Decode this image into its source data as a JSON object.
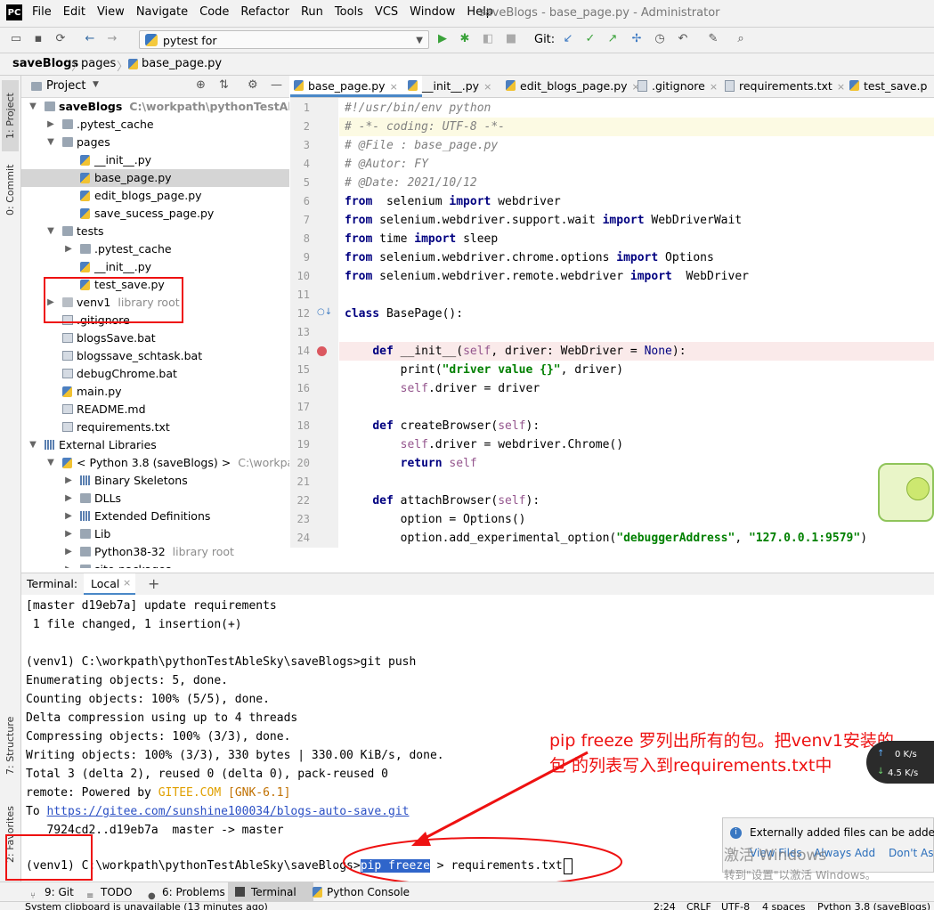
{
  "window": {
    "logo": "PC",
    "title": "saveBlogs - base_page.py - Administrator",
    "menu": [
      "File",
      "Edit",
      "View",
      "Navigate",
      "Code",
      "Refactor",
      "Run",
      "Tools",
      "VCS",
      "Window",
      "Help"
    ]
  },
  "toolbar": {
    "run_config": "pytest for test_save.TestSave.test_continue_edit",
    "git_label": "Git:"
  },
  "breadcrumb": [
    "saveBlogs",
    "pages",
    "base_page.py"
  ],
  "project": {
    "header": "Project",
    "tree": [
      {
        "label": "saveBlogs",
        "hint": "C:\\workpath\\pythonTestAbleSky\\s",
        "depth": 0,
        "arrow": "down",
        "icon": "folder",
        "bold": true
      },
      {
        "label": ".pytest_cache",
        "depth": 1,
        "arrow": "right",
        "icon": "folder"
      },
      {
        "label": "pages",
        "depth": 1,
        "arrow": "down",
        "icon": "folder"
      },
      {
        "label": "__init__.py",
        "depth": 2,
        "icon": "py"
      },
      {
        "label": "base_page.py",
        "depth": 2,
        "icon": "py",
        "selected": true
      },
      {
        "label": "edit_blogs_page.py",
        "depth": 2,
        "icon": "py"
      },
      {
        "label": "save_sucess_page.py",
        "depth": 2,
        "icon": "py"
      },
      {
        "label": "tests",
        "depth": 1,
        "arrow": "down",
        "icon": "folder"
      },
      {
        "label": ".pytest_cache",
        "depth": 2,
        "arrow": "right",
        "icon": "folder"
      },
      {
        "label": "__init__.py",
        "depth": 2,
        "icon": "py"
      },
      {
        "label": "test_save.py",
        "depth": 2,
        "icon": "py"
      },
      {
        "label": "venv1",
        "hint": "library root",
        "depth": 1,
        "arrow": "right",
        "icon": "folder-gray"
      },
      {
        "label": ".gitignore",
        "depth": 1,
        "icon": "file"
      },
      {
        "label": "blogsSave.bat",
        "depth": 1,
        "icon": "file"
      },
      {
        "label": "blogssave_schtask.bat",
        "depth": 1,
        "icon": "file"
      },
      {
        "label": "debugChrome.bat",
        "depth": 1,
        "icon": "file"
      },
      {
        "label": "main.py",
        "depth": 1,
        "icon": "py"
      },
      {
        "label": "README.md",
        "depth": 1,
        "icon": "file"
      },
      {
        "label": "requirements.txt",
        "depth": 1,
        "icon": "file"
      },
      {
        "label": "External Libraries",
        "depth": 0,
        "arrow": "down",
        "icon": "libs"
      },
      {
        "label": "< Python 3.8 (saveBlogs) >",
        "hint": "C:\\workpath\\",
        "depth": 1,
        "arrow": "down",
        "icon": "py"
      },
      {
        "label": "Binary Skeletons",
        "depth": 2,
        "arrow": "right",
        "icon": "libs"
      },
      {
        "label": "DLLs",
        "depth": 2,
        "arrow": "right",
        "icon": "folder"
      },
      {
        "label": "Extended Definitions",
        "depth": 2,
        "arrow": "right",
        "icon": "libs"
      },
      {
        "label": "Lib",
        "depth": 2,
        "arrow": "right",
        "icon": "folder"
      },
      {
        "label": "Python38-32",
        "hint": "library root",
        "depth": 2,
        "arrow": "right",
        "icon": "folder"
      },
      {
        "label": "site-packages",
        "depth": 2,
        "arrow": "right",
        "icon": "folder"
      }
    ]
  },
  "editor_tabs": [
    {
      "label": "base_page.py",
      "active": true
    },
    {
      "label": "__init__.py"
    },
    {
      "label": "edit_blogs_page.py"
    },
    {
      "label": ".gitignore"
    },
    {
      "label": "requirements.txt"
    },
    {
      "label": "test_save.p"
    }
  ],
  "code_lines": [
    {
      "n": "1",
      "t": [
        [
          "cm",
          "#!/usr/bin/env python"
        ]
      ]
    },
    {
      "n": "2",
      "t": [
        [
          "cm",
          "# -*- coding: UTF-8 -*-"
        ]
      ],
      "hl": "current"
    },
    {
      "n": "3",
      "t": [
        [
          "cm",
          "# @File : base_page.py"
        ]
      ]
    },
    {
      "n": "4",
      "t": [
        [
          "cm",
          "# @Autor: FY"
        ]
      ]
    },
    {
      "n": "5",
      "t": [
        [
          "cm",
          "# @Date: 2021/10/12"
        ]
      ]
    },
    {
      "n": "6",
      "t": [
        [
          "kw",
          "from"
        ],
        [
          "",
          "  selenium "
        ],
        [
          "kw",
          "import"
        ],
        [
          "",
          " webdriver"
        ]
      ]
    },
    {
      "n": "7",
      "t": [
        [
          "kw",
          "from"
        ],
        [
          "",
          " selenium.webdriver.support.wait "
        ],
        [
          "kw",
          "import"
        ],
        [
          "",
          " WebDriverWait"
        ]
      ]
    },
    {
      "n": "8",
      "t": [
        [
          "kw",
          "from"
        ],
        [
          "",
          " time "
        ],
        [
          "kw",
          "import"
        ],
        [
          "",
          " sleep"
        ]
      ]
    },
    {
      "n": "9",
      "t": [
        [
          "kw",
          "from"
        ],
        [
          "",
          " selenium.webdriver.chrome.options "
        ],
        [
          "kw",
          "import"
        ],
        [
          "",
          " Options"
        ]
      ]
    },
    {
      "n": "10",
      "t": [
        [
          "kw",
          "from"
        ],
        [
          "",
          " selenium.webdriver.remote.webdriver "
        ],
        [
          "kw",
          "import"
        ],
        [
          "",
          "  WebDriver"
        ]
      ]
    },
    {
      "n": "11",
      "t": []
    },
    {
      "n": "12",
      "t": [
        [
          "kw",
          "class"
        ],
        [
          "",
          " BasePage():"
        ]
      ]
    },
    {
      "n": "13",
      "t": []
    },
    {
      "n": "14",
      "t": [
        [
          "",
          "    "
        ],
        [
          "kw",
          "def"
        ],
        [
          "",
          " __init__("
        ],
        [
          "slf",
          "self"
        ],
        [
          "",
          ", driver: WebDriver = "
        ],
        [
          "bi",
          "None"
        ],
        [
          "",
          "):"
        ]
      ],
      "hl": "breakpoint"
    },
    {
      "n": "15",
      "t": [
        [
          "",
          "        print("
        ],
        [
          "st",
          "\"driver value {}\""
        ],
        [
          "",
          ", driver)"
        ]
      ]
    },
    {
      "n": "16",
      "t": [
        [
          "",
          "        "
        ],
        [
          "slf",
          "self"
        ],
        [
          "",
          ".driver = driver"
        ]
      ]
    },
    {
      "n": "17",
      "t": []
    },
    {
      "n": "18",
      "t": [
        [
          "",
          "    "
        ],
        [
          "kw",
          "def"
        ],
        [
          "",
          " createBrowser("
        ],
        [
          "slf",
          "self"
        ],
        [
          "",
          "):"
        ]
      ]
    },
    {
      "n": "19",
      "t": [
        [
          "",
          "        "
        ],
        [
          "slf",
          "self"
        ],
        [
          "",
          ".driver = webdriver.Chrome()"
        ]
      ]
    },
    {
      "n": "20",
      "t": [
        [
          "",
          "        "
        ],
        [
          "kw",
          "return"
        ],
        [
          "",
          " "
        ],
        [
          "slf",
          "self"
        ]
      ]
    },
    {
      "n": "21",
      "t": []
    },
    {
      "n": "22",
      "t": [
        [
          "",
          "    "
        ],
        [
          "kw",
          "def"
        ],
        [
          "",
          " attachBrowser("
        ],
        [
          "slf",
          "self"
        ],
        [
          "",
          "):"
        ]
      ]
    },
    {
      "n": "23",
      "t": [
        [
          "",
          "        option = Options()"
        ]
      ]
    },
    {
      "n": "24",
      "t": [
        [
          "",
          "        option.add_experimental_option("
        ],
        [
          "st",
          "\"debuggerAddress\""
        ],
        [
          "",
          ", "
        ],
        [
          "st",
          "\"127.0.0.1:9579\""
        ],
        [
          "",
          ")"
        ]
      ]
    }
  ],
  "terminal": {
    "title": "Terminal:",
    "tab": "Local",
    "lines": [
      "[master d19eb7a] update requirements",
      " 1 file changed, 1 insertion(+)",
      "",
      "(venv1) C:\\workpath\\pythonTestAbleSky\\saveBlogs>git push",
      "Enumerating objects: 5, done.",
      "Counting objects: 100% (5/5), done.",
      "Delta compression using up to 4 threads",
      "Compressing objects: 100% (3/3), done.",
      "Writing objects: 100% (3/3), 330 bytes | 330.00 KiB/s, done.",
      "Total 3 (delta 2), reused 0 (delta 0), pack-reused 0"
    ],
    "remote_prefix": "remote: Powered by ",
    "remote_gitee": "GITEE.COM",
    "remote_version": "[GNK-6.1]",
    "to_prefix": "To ",
    "to_link": "https://gitee.com/sunshine100034/blogs-auto-save.git",
    "push_result": "   7924cd2..d19eb7a  master -> master",
    "prompt": "(venv1) C:\\workpath\\pythonTestAbleSky\\saveBlogs>",
    "cmd_highlight": "pip freeze",
    "cmd_rest": " > requirements.txt"
  },
  "annotation": {
    "line1": "pip freeze 罗列出所有的包。把venv1安装的",
    "line2": "包 的列表写入到requirements.txt中"
  },
  "notification": {
    "text": "Externally added files can be added",
    "links": [
      "View Files",
      "Always Add",
      "Don't Ask"
    ]
  },
  "watermark": {
    "line1": "激活 Windows",
    "line2": "转到\"设置\"以激活 Windows。"
  },
  "network": {
    "up": "0 K/s",
    "down": "4.5 K/s"
  },
  "left_tabs": [
    "1: Project",
    "0: Commit",
    "7: Structure",
    "2: Favorites"
  ],
  "tool_tabs": [
    "9: Git",
    "TODO",
    "6: Problems",
    "Terminal",
    "Python Console"
  ],
  "status": {
    "left": "System clipboard is unavailable (13 minutes ago)",
    "right": [
      "2:24",
      "CRLF",
      "UTF-8",
      "4 spaces",
      "Python 3.8 (saveBlogs)"
    ]
  },
  "colors": {
    "accent": "#4a88c7",
    "annotation_red": "#e11111",
    "breakpoint": "#db5860",
    "current_line": "#fcfae3",
    "breakpoint_line": "#faeaea"
  }
}
